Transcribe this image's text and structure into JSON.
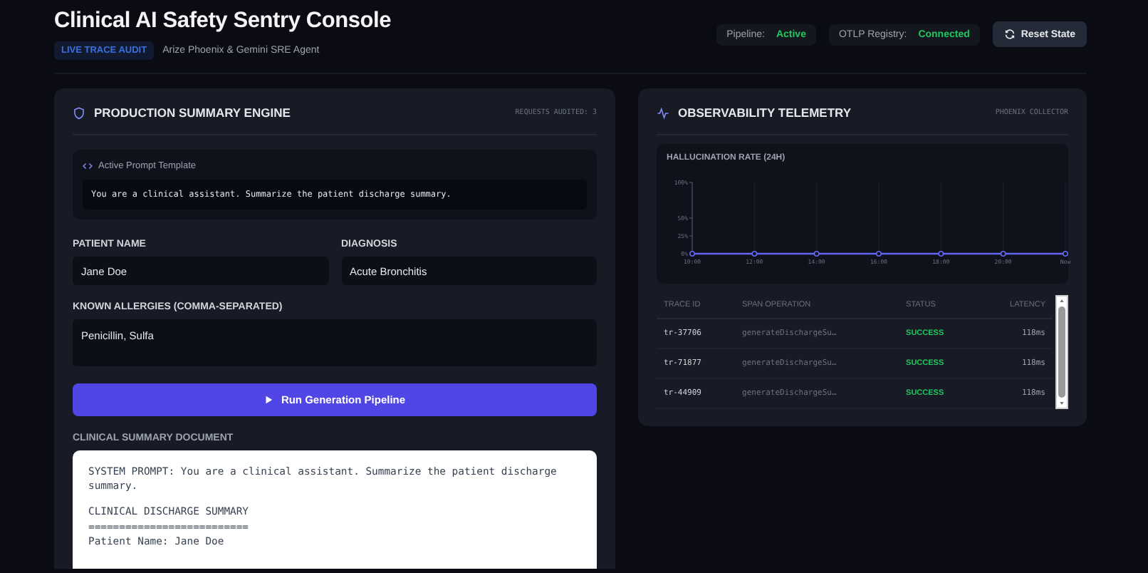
{
  "header": {
    "title": "Clinical AI Safety Sentry Console",
    "badge": "LIVE TRACE AUDIT",
    "subtitle": "Arize Phoenix & Gemini SRE Agent",
    "statuses": [
      {
        "label": "Pipeline:",
        "value": "Active"
      },
      {
        "label": "OTLP Registry:",
        "value": "Connected"
      }
    ],
    "reset_button": "Reset State"
  },
  "summary_panel": {
    "title": "PRODUCTION SUMMARY ENGINE",
    "counter": "REQUESTS AUDITED: 3",
    "prompt_template": {
      "label": "Active Prompt Template",
      "text": "You are a clinical assistant. Summarize the patient discharge summary."
    },
    "fields": [
      {
        "label": "PATIENT NAME",
        "value": "Jane Doe",
        "kind": "input"
      },
      {
        "label": "DIAGNOSIS",
        "value": "Acute Bronchitis",
        "kind": "input"
      },
      {
        "label": "KNOWN ALLERGIES (COMMA-SEPARATED)",
        "value": "Penicillin, Sulfa",
        "kind": "textarea"
      }
    ],
    "run_button": "Run Generation Pipeline",
    "document": {
      "title": "CLINICAL SUMMARY DOCUMENT",
      "blocks": [
        [
          "SYSTEM PROMPT: You are a clinical assistant. Summarize the patient discharge summary."
        ],
        [
          "CLINICAL DISCHARGE SUMMARY",
          "==========================",
          "Patient Name: Jane Doe"
        ]
      ]
    }
  },
  "telemetry_panel": {
    "title": "OBSERVABILITY TELEMETRY",
    "source": "PHOENIX COLLECTOR",
    "chart_data": {
      "type": "line",
      "title": "HALLUCINATION RATE (24H)",
      "categories": [
        "10:00",
        "12:00",
        "14:00",
        "16:00",
        "18:00",
        "20:00",
        "Now"
      ],
      "grid": true,
      "series": [
        {
          "color": "#6366f1",
          "marker": true,
          "values": [
            0,
            0,
            0,
            0,
            0,
            0,
            0
          ]
        }
      ],
      "ylim": [
        0,
        100
      ],
      "yticks": [
        {
          "value": 0,
          "label": "0%"
        },
        {
          "value": 25,
          "label": "25%"
        },
        {
          "value": 50,
          "label": "50%"
        },
        {
          "value": 100,
          "label": "100%"
        }
      ]
    },
    "table": {
      "columns": [
        "TRACE ID",
        "SPAN OPERATION",
        "STATUS",
        "LATENCY"
      ],
      "rows": [
        {
          "trace_id": "tr-37706",
          "operation": "generateDischargeSu…",
          "status": "SUCCESS",
          "latency": "118ms"
        },
        {
          "trace_id": "tr-71877",
          "operation": "generateDischargeSu…",
          "status": "SUCCESS",
          "latency": "118ms"
        },
        {
          "trace_id": "tr-44909",
          "operation": "generateDischargeSu…",
          "status": "SUCCESS",
          "latency": "118ms"
        }
      ]
    }
  }
}
